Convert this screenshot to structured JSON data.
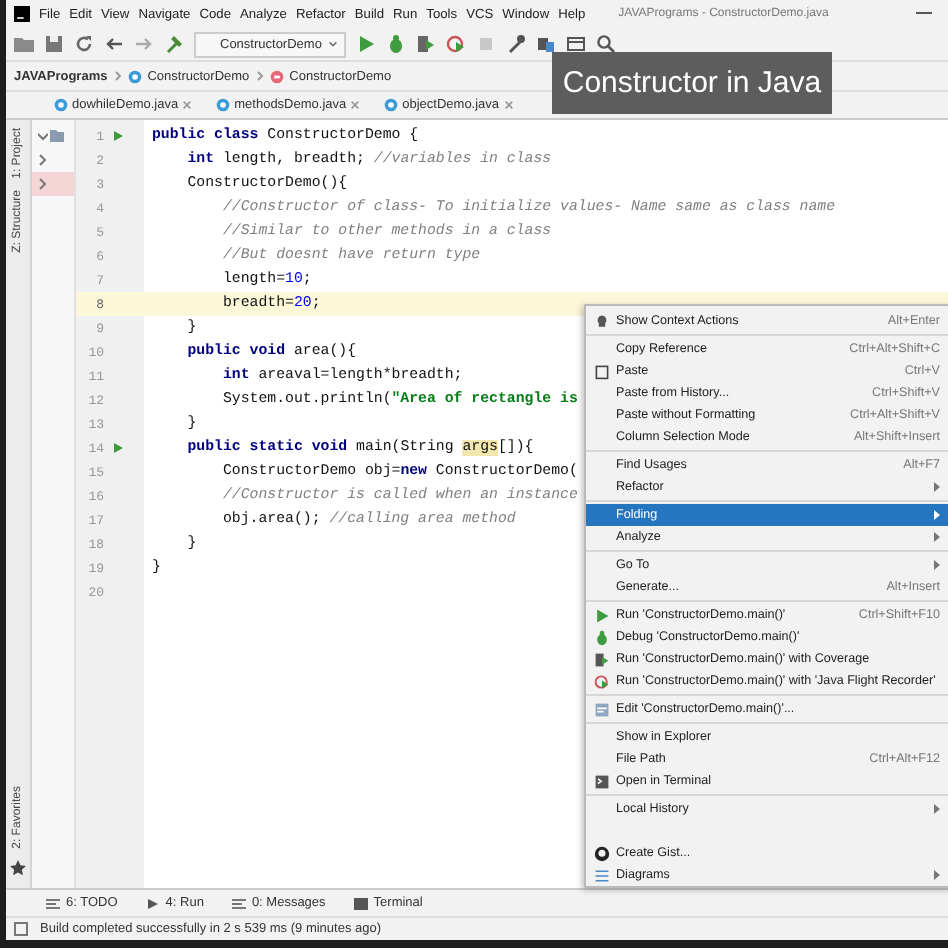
{
  "window": {
    "title": "JAVAPrograms - ConstructorDemo.java"
  },
  "menu_bar": [
    "File",
    "Edit",
    "View",
    "Navigate",
    "Code",
    "Analyze",
    "Refactor",
    "Build",
    "Run",
    "Tools",
    "VCS",
    "Window",
    "Help"
  ],
  "toolbar": {
    "run_configuration": "ConstructorDemo"
  },
  "breadcrumb": [
    "JAVAPrograms",
    "ConstructorDemo",
    "ConstructorDemo"
  ],
  "tabs": [
    {
      "label": "dowhileDemo.java",
      "selected": false
    },
    {
      "label": "methodsDemo.java",
      "selected": false
    },
    {
      "label": "objectDemo.java",
      "selected": false
    }
  ],
  "caption": "Constructor in Java",
  "side_tools": [
    "1: Project",
    "Z: Structure",
    "2: Favorites"
  ],
  "editor": {
    "lines": [
      {
        "number": "1",
        "current": false,
        "run_marker": true,
        "tokens": [
          {
            "kind": "kw",
            "text": "public class "
          },
          {
            "kind": "plain",
            "text": "ConstructorDemo {"
          }
        ]
      },
      {
        "number": "2",
        "current": false,
        "run_marker": false,
        "tokens": [
          {
            "kind": "kw",
            "text": "    int "
          },
          {
            "kind": "plain",
            "text": "length, breadth; "
          },
          {
            "kind": "comment",
            "text": "//variables in class"
          }
        ]
      },
      {
        "number": "3",
        "current": false,
        "run_marker": false,
        "tokens": [
          {
            "kind": "plain",
            "text": "    ConstructorDemo(){"
          }
        ]
      },
      {
        "number": "4",
        "current": false,
        "run_marker": false,
        "tokens": [
          {
            "kind": "comment",
            "text": "        //Constructor of class- To initialize values- Name same as class name"
          }
        ]
      },
      {
        "number": "5",
        "current": false,
        "run_marker": false,
        "tokens": [
          {
            "kind": "comment",
            "text": "        //Similar to other methods in a class"
          }
        ]
      },
      {
        "number": "6",
        "current": false,
        "run_marker": false,
        "tokens": [
          {
            "kind": "comment",
            "text": "        //But doesnt have return type"
          }
        ]
      },
      {
        "number": "7",
        "current": false,
        "run_marker": false,
        "tokens": [
          {
            "kind": "plain",
            "text": "        length="
          },
          {
            "kind": "num",
            "text": "10"
          },
          {
            "kind": "plain",
            "text": ";"
          }
        ]
      },
      {
        "number": "8",
        "current": true,
        "run_marker": false,
        "tokens": [
          {
            "kind": "plain",
            "text": "        breadth="
          },
          {
            "kind": "num",
            "text": "20"
          },
          {
            "kind": "plain",
            "text": ";"
          }
        ]
      },
      {
        "number": "9",
        "current": false,
        "run_marker": false,
        "tokens": [
          {
            "kind": "plain",
            "text": "    }"
          }
        ]
      },
      {
        "number": "10",
        "current": false,
        "run_marker": false,
        "tokens": [
          {
            "kind": "kw",
            "text": "    public void "
          },
          {
            "kind": "plain",
            "text": "area(){"
          }
        ]
      },
      {
        "number": "11",
        "current": false,
        "run_marker": false,
        "tokens": [
          {
            "kind": "kw",
            "text": "        int "
          },
          {
            "kind": "plain",
            "text": "areaval=length*breadth;"
          }
        ]
      },
      {
        "number": "12",
        "current": false,
        "run_marker": false,
        "tokens": [
          {
            "kind": "plain",
            "text": "        System.out.println("
          },
          {
            "kind": "str",
            "text": "\"Area of rectangle is"
          }
        ]
      },
      {
        "number": "13",
        "current": false,
        "run_marker": false,
        "tokens": [
          {
            "kind": "plain",
            "text": "    }"
          }
        ]
      },
      {
        "number": "14",
        "current": false,
        "run_marker": true,
        "tokens": [
          {
            "kind": "kw",
            "text": "    public static void "
          },
          {
            "kind": "plain",
            "text": "main(String "
          },
          {
            "kind": "hl",
            "text": "args"
          },
          {
            "kind": "plain",
            "text": "[]){"
          }
        ]
      },
      {
        "number": "15",
        "current": false,
        "run_marker": false,
        "tokens": [
          {
            "kind": "plain",
            "text": "        ConstructorDemo obj="
          },
          {
            "kind": "kw",
            "text": "new"
          },
          {
            "kind": "plain",
            "text": " ConstructorDemo("
          }
        ]
      },
      {
        "number": "16",
        "current": false,
        "run_marker": false,
        "tokens": [
          {
            "kind": "comment",
            "text": "        //Constructor is called when an instance"
          }
        ]
      },
      {
        "number": "17",
        "current": false,
        "run_marker": false,
        "tokens": [
          {
            "kind": "plain",
            "text": "        obj.area(); "
          },
          {
            "kind": "comment",
            "text": "//calling area method"
          }
        ]
      },
      {
        "number": "18",
        "current": false,
        "run_marker": false,
        "tokens": [
          {
            "kind": "plain",
            "text": "    }"
          }
        ]
      },
      {
        "number": "19",
        "current": false,
        "run_marker": false,
        "tokens": [
          {
            "kind": "plain",
            "text": "}"
          }
        ]
      },
      {
        "number": "20",
        "current": false,
        "run_marker": false
      }
    ]
  },
  "context_menu": [
    {
      "label": "Show Context Actions",
      "shortcut": "Alt+Enter",
      "submenu": false,
      "selected": false
    },
    {
      "kind": "separator"
    },
    {
      "label": "Copy Reference",
      "shortcut": "Ctrl+Alt+Shift+C",
      "submenu": false,
      "selected": false
    },
    {
      "label": "Paste",
      "shortcut": "Ctrl+V",
      "submenu": false,
      "selected": false
    },
    {
      "label": "Paste from History...",
      "shortcut": "Ctrl+Shift+V",
      "submenu": false,
      "selected": false
    },
    {
      "label": "Paste without Formatting",
      "shortcut": "Ctrl+Alt+Shift+V",
      "submenu": false,
      "selected": false
    },
    {
      "label": "Column Selection Mode",
      "shortcut": "Alt+Shift+Insert",
      "submenu": false,
      "selected": false
    },
    {
      "kind": "separator"
    },
    {
      "label": "Find Usages",
      "shortcut": "Alt+F7",
      "submenu": false,
      "selected": false
    },
    {
      "label": "Refactor",
      "submenu": true,
      "selected": false
    },
    {
      "kind": "separator"
    },
    {
      "label": "Folding",
      "submenu": true,
      "selected": true
    },
    {
      "label": "Analyze",
      "submenu": true,
      "selected": false
    },
    {
      "kind": "separator"
    },
    {
      "label": "Go To",
      "submenu": true,
      "selected": false
    },
    {
      "label": "Generate...",
      "shortcut": "Alt+Insert",
      "submenu": false,
      "selected": false
    },
    {
      "kind": "separator"
    },
    {
      "label": "Run 'ConstructorDemo.main()'",
      "shortcut": "Ctrl+Shift+F10",
      "submenu": false,
      "selected": false
    },
    {
      "label": "Debug 'ConstructorDemo.main()'",
      "submenu": false,
      "selected": false
    },
    {
      "label": "Run 'ConstructorDemo.main()' with Coverage",
      "submenu": false,
      "selected": false
    },
    {
      "label": "Run 'ConstructorDemo.main()' with 'Java Flight Recorder'",
      "submenu": false,
      "selected": false
    },
    {
      "kind": "separator"
    },
    {
      "label": "Edit 'ConstructorDemo.main()'...",
      "submenu": false,
      "selected": false
    },
    {
      "kind": "separator"
    },
    {
      "label": "Show in Explorer",
      "submenu": false,
      "selected": false
    },
    {
      "label": "File Path",
      "shortcut": "Ctrl+Alt+F12",
      "submenu": false,
      "selected": false
    },
    {
      "label": "Open in Terminal",
      "submenu": false,
      "selected": false
    },
    {
      "kind": "separator"
    },
    {
      "label": "Local History",
      "submenu": true,
      "selected": false
    },
    {
      "kind": "hidden"
    },
    {
      "label": "Create Gist...",
      "submenu": false,
      "selected": false
    },
    {
      "label": "Diagrams",
      "submenu": true,
      "selected": false
    }
  ],
  "tool_windows": [
    "6: TODO",
    "4: Run",
    "0: Messages",
    "Terminal"
  ],
  "status_bar": "Build completed successfully in 2 s 539 ms (9 minutes ago)"
}
